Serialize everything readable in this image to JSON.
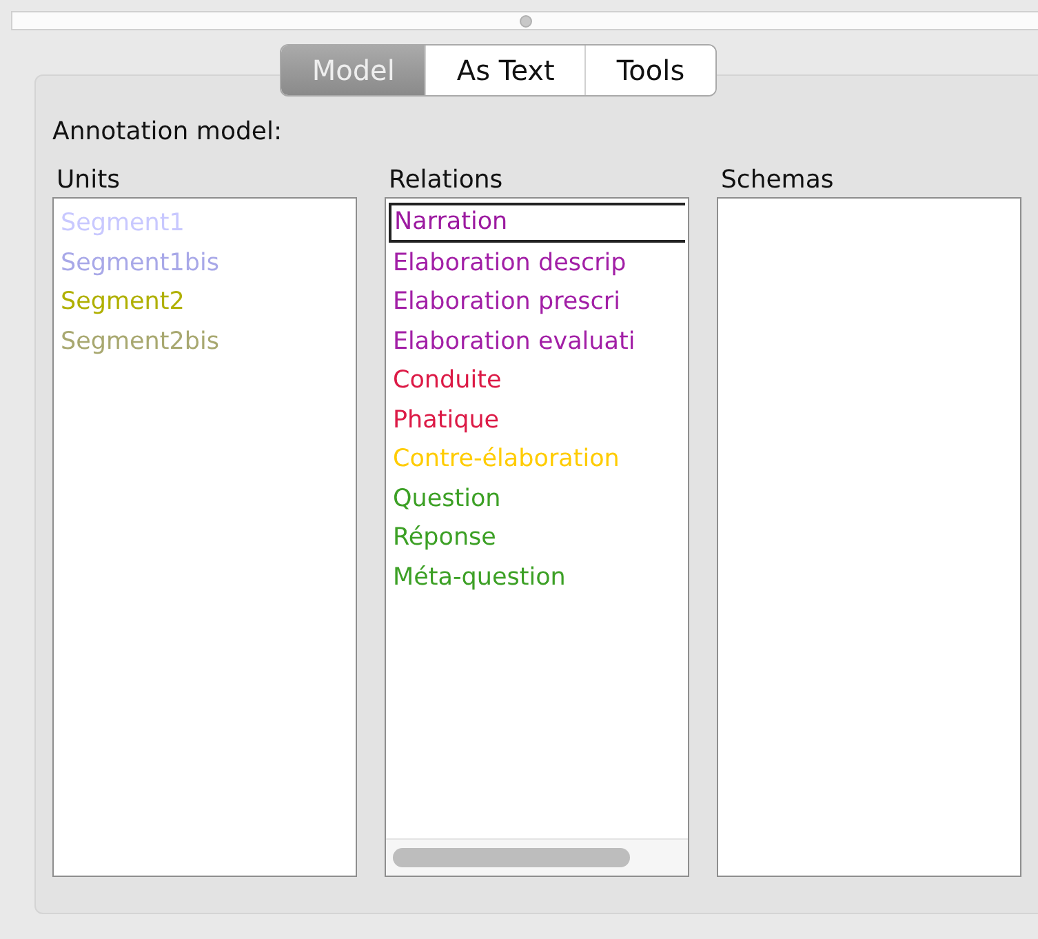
{
  "tabs": [
    {
      "label": "Model",
      "selected": true
    },
    {
      "label": "As Text",
      "selected": false
    },
    {
      "label": "Tools",
      "selected": false
    }
  ],
  "heading": "Annotation model:",
  "units": {
    "label": "Units",
    "items": [
      {
        "label": "Segment1",
        "color": "#c8c8ff",
        "selected": false
      },
      {
        "label": "Segment1bis",
        "color": "#a8a8e8",
        "selected": false
      },
      {
        "label": "Segment2",
        "color": "#b0b000",
        "selected": false
      },
      {
        "label": "Segment2bis",
        "color": "#a8a870",
        "selected": false
      }
    ]
  },
  "relations": {
    "label": "Relations",
    "items": [
      {
        "label": "Narration",
        "color": "#9c1aa0",
        "selected": true
      },
      {
        "label": "Elaboration descrip",
        "color": "#a21fa6",
        "selected": false
      },
      {
        "label": "Elaboration prescri",
        "color": "#a21fa6",
        "selected": false
      },
      {
        "label": "Elaboration evaluati",
        "color": "#a21fa6",
        "selected": false
      },
      {
        "label": "Conduite",
        "color": "#dc1a46",
        "selected": false
      },
      {
        "label": "Phatique",
        "color": "#dc1a46",
        "selected": false
      },
      {
        "label": "Contre-élaboration",
        "color": "#ffcc00",
        "selected": false
      },
      {
        "label": "Question",
        "color": "#3ca025",
        "selected": false
      },
      {
        "label": "Réponse",
        "color": "#3ca025",
        "selected": false
      },
      {
        "label": "Méta-question",
        "color": "#3ca025",
        "selected": false
      }
    ]
  },
  "schemas": {
    "label": "Schemas"
  }
}
